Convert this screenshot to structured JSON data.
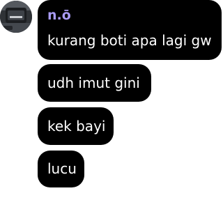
{
  "chat": {
    "sender": {
      "name": "n.ō",
      "name_color": "#a99cf4",
      "avatar_icon": "profile-photo"
    },
    "messages": [
      {
        "text": "kurang boti apa lagi gw"
      },
      {
        "text": "udh imut gini"
      },
      {
        "text": "kek bayi"
      },
      {
        "text": "lucu"
      }
    ],
    "bubble_color": "#000000",
    "text_color": "#ffffff"
  }
}
